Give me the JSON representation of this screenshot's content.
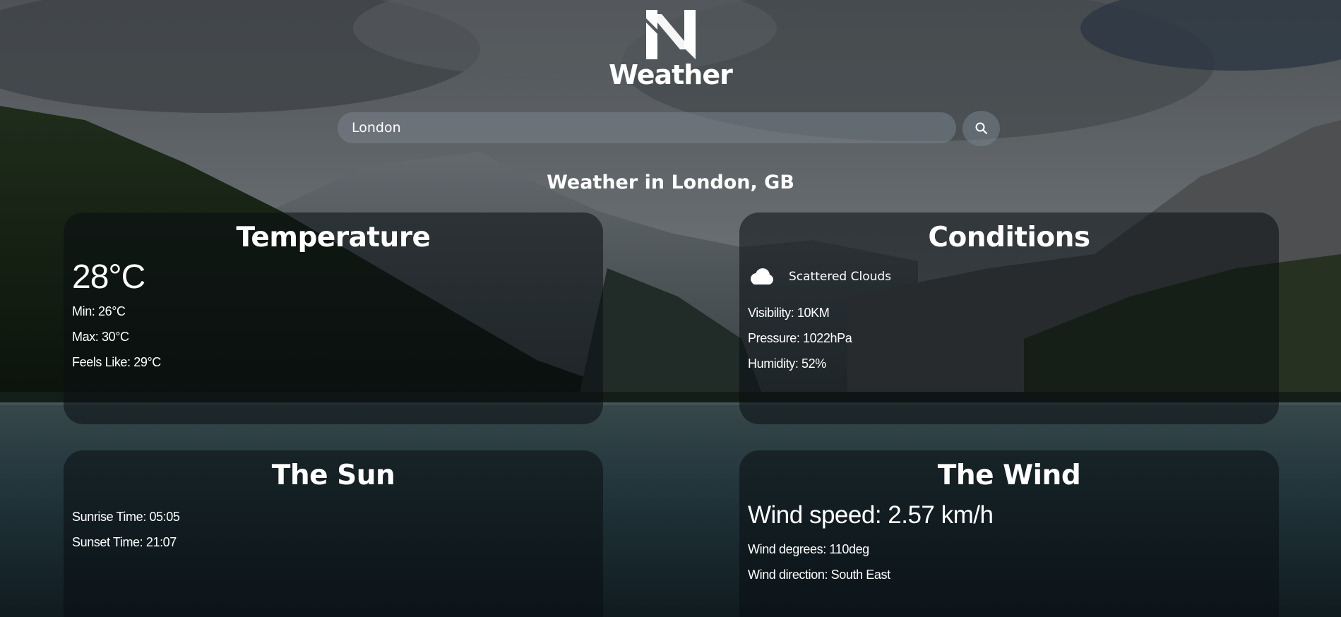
{
  "brand": {
    "logo_text": "Weather"
  },
  "search": {
    "value": "London",
    "placeholder": ""
  },
  "location_title": "Weather in London, GB",
  "temperature": {
    "title": "Temperature",
    "current": "28°C",
    "min": "Min: 26°C",
    "max": "Max: 30°C",
    "feels_like": "Feels Like: 29°C"
  },
  "conditions": {
    "title": "Conditions",
    "icon": "cloud-icon",
    "description": "Scattered Clouds",
    "visibility": "Visibility: 10KM",
    "pressure": "Pressure: 1022hPa",
    "humidity": "Humidity: 52%"
  },
  "sun": {
    "title": "The Sun",
    "sunrise": "Sunrise Time: 05:05",
    "sunset": "Sunset Time: 21:07"
  },
  "wind": {
    "title": "The Wind",
    "speed": "Wind speed: 2.57 km/h",
    "degrees": "Wind degrees: 110deg",
    "direction": "Wind direction: South East"
  },
  "icons": {
    "search_button": "search-icon",
    "logo": "logo-n-icon"
  }
}
